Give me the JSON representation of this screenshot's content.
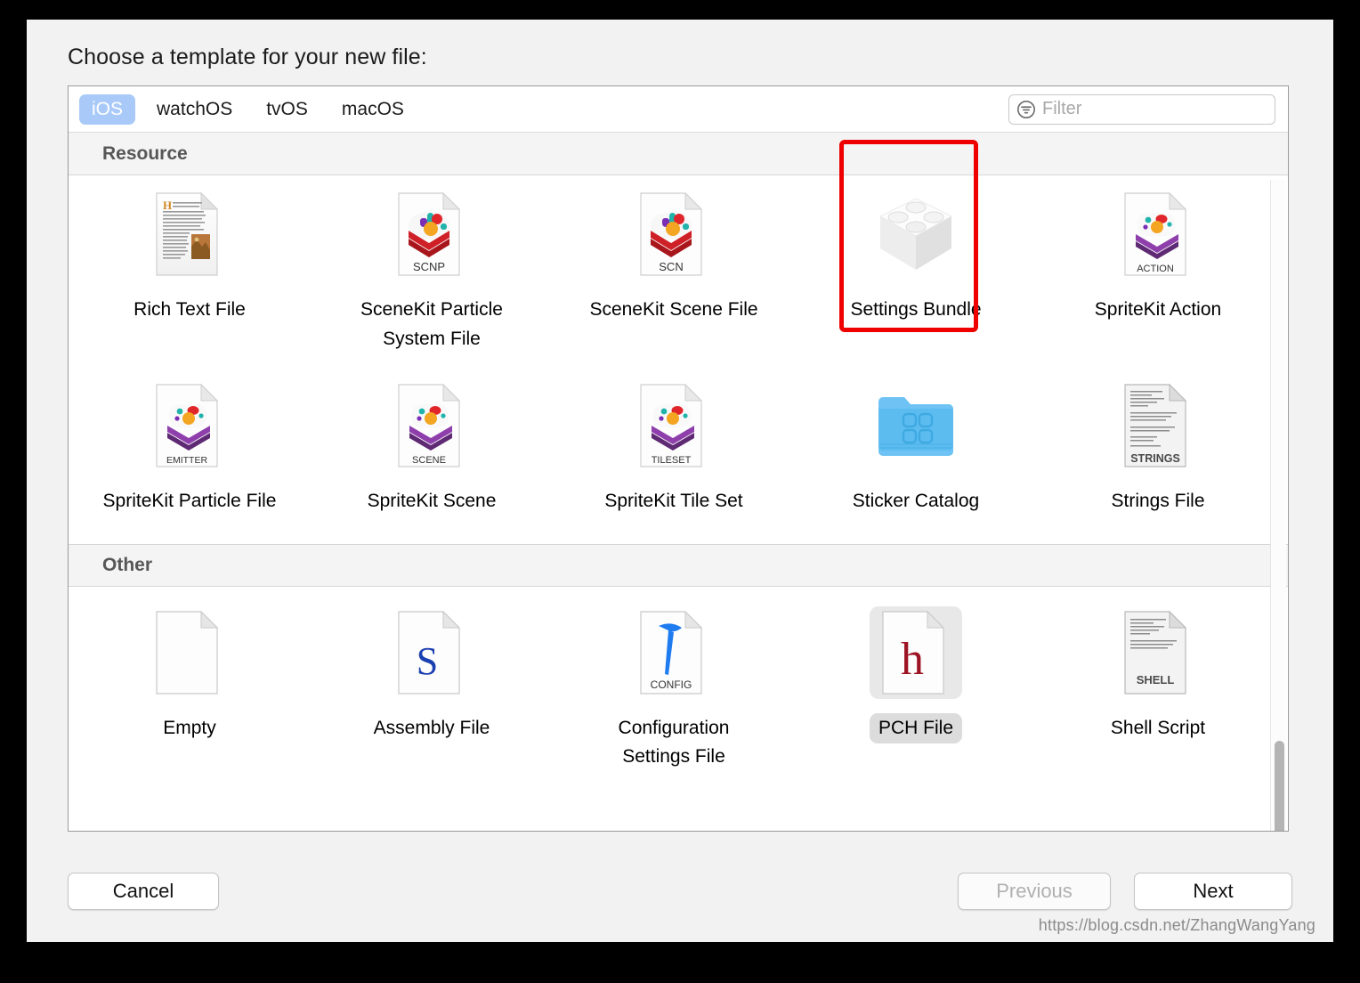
{
  "dialog": {
    "title": "Choose a template for your new file:"
  },
  "tabs": [
    {
      "label": "iOS",
      "selected": true
    },
    {
      "label": "watchOS",
      "selected": false
    },
    {
      "label": "tvOS",
      "selected": false
    },
    {
      "label": "macOS",
      "selected": false
    }
  ],
  "filter": {
    "placeholder": "Filter",
    "value": "",
    "icon": "filter-icon"
  },
  "sections": [
    {
      "title": "Resource",
      "rows": [
        [
          {
            "label": "Rich Text File",
            "icon": "rich-text-file-icon",
            "badge": "",
            "selected": false
          },
          {
            "label": "SceneKit Particle System File",
            "icon": "scenekit-particle-icon",
            "badge": "SCNP",
            "selected": false
          },
          {
            "label": "SceneKit Scene File",
            "icon": "scenekit-scene-icon",
            "badge": "SCN",
            "selected": false
          },
          {
            "label": "Settings Bundle",
            "icon": "settings-bundle-icon",
            "badge": "",
            "selected": false
          },
          {
            "label": "SpriteKit Action",
            "icon": "spritekit-action-icon",
            "badge": "ACTION",
            "selected": false
          }
        ],
        [
          {
            "label": "SpriteKit Particle File",
            "icon": "spritekit-emitter-icon",
            "badge": "EMITTER",
            "selected": false
          },
          {
            "label": "SpriteKit Scene",
            "icon": "spritekit-scene-icon",
            "badge": "SCENE",
            "selected": false
          },
          {
            "label": "SpriteKit Tile Set",
            "icon": "spritekit-tileset-icon",
            "badge": "TILESET",
            "selected": false
          },
          {
            "label": "Sticker Catalog",
            "icon": "sticker-catalog-folder-icon",
            "badge": "",
            "selected": false
          },
          {
            "label": "Strings File",
            "icon": "strings-file-icon",
            "badge": "STRINGS",
            "selected": false
          }
        ]
      ]
    },
    {
      "title": "Other",
      "rows": [
        [
          {
            "label": "Empty",
            "icon": "empty-document-icon",
            "badge": "",
            "selected": false
          },
          {
            "label": "Assembly File",
            "icon": "assembly-file-icon",
            "badge": "",
            "selected": false
          },
          {
            "label": "Configuration Settings File",
            "icon": "config-settings-icon",
            "badge": "CONFIG",
            "selected": false
          },
          {
            "label": "PCH File",
            "icon": "pch-file-icon",
            "badge": "",
            "selected": true
          },
          {
            "label": "Shell Script",
            "icon": "shell-script-icon",
            "badge": "SHELL",
            "selected": false
          }
        ]
      ]
    }
  ],
  "buttons": {
    "cancel": "Cancel",
    "previous": "Previous",
    "next": "Next"
  },
  "watermark": "https://blog.csdn.net/ZhangWangYang",
  "colors": {
    "tab_selected_bg": "#a9caf8",
    "annotation": "#ee0000",
    "selection_bg": "#dcdcdc",
    "section_header_bg": "#f4f4f4"
  }
}
